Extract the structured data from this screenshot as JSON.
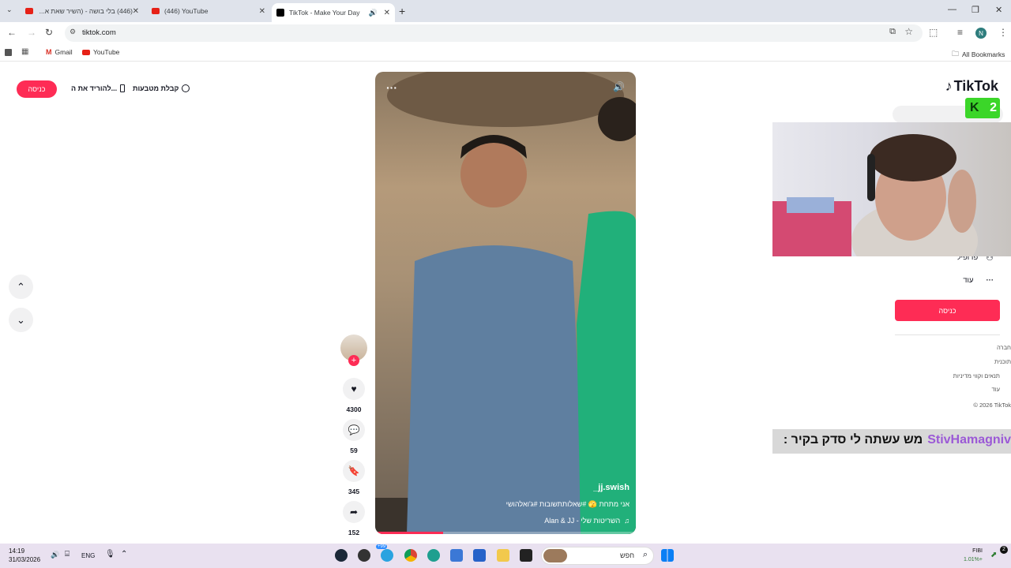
{
  "browser": {
    "tabs": [
      {
        "title": "(446) בלי בושה - (השיר שאת א..."
      },
      {
        "title": "(446) YouTube"
      },
      {
        "title": "TikTok - Make Your Day"
      }
    ],
    "url": "tiktok.com",
    "bookmarks": [
      {
        "label": "Gmail"
      },
      {
        "label": "YouTube"
      }
    ],
    "all_bookmarks": "All Bookmarks",
    "profile_initial": "N"
  },
  "page": {
    "login_top": "כניסה",
    "download_app": "להוריד את ה...",
    "get_coins": "קבלת מטבעות",
    "video": {
      "username": "_jj.swish",
      "caption": "אני מתחת 🫣 #שאלותתשובות #ג'ואלהושי",
      "music": "Alan & JJ - השריטות שלי",
      "progress": 0.26
    },
    "actions": {
      "likes": "4300",
      "comments": "59",
      "saves": "345",
      "shares": "152"
    },
    "sidebar": {
      "logo": "TikTok",
      "profile": "פרופיל",
      "more": "עוד",
      "login": "כניסה",
      "footer": [
        "חברה",
        "תוכנית",
        "תנאים וקווי מדיניות",
        "עוד"
      ],
      "copyright": "© 2026 TikTok"
    },
    "overlay": {
      "badge_number": "2",
      "ticker_user": "StivHamagniv",
      "ticker_text": "מש עשתה לי סדק בקיר :"
    }
  },
  "taskbar": {
    "time": "14:19",
    "date": "31/03/2026",
    "lang": "ENG",
    "search_placeholder": "חפש",
    "badge": "+99",
    "stock_name": "FIBI",
    "stock_change": "1.01%+",
    "notif_count": "2"
  }
}
